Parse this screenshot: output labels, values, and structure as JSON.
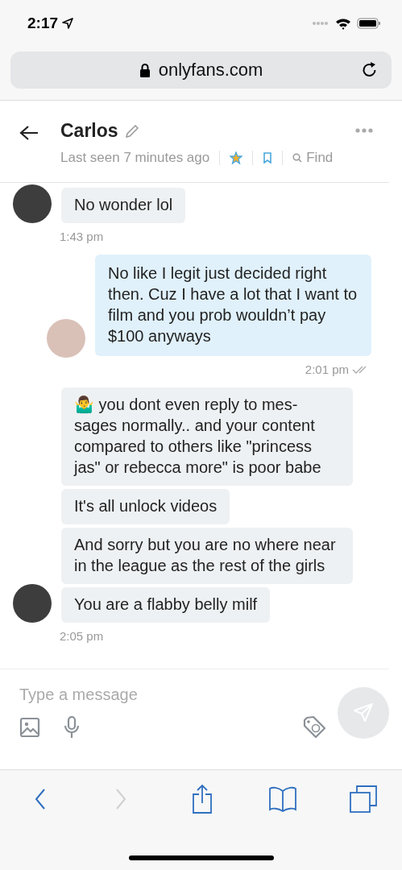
{
  "status_bar": {
    "time": "2:17"
  },
  "address_bar": {
    "url": "onlyfans.com"
  },
  "chat_header": {
    "name": "Carlos",
    "last_seen": "Last seen 7 minutes ago",
    "starred": true,
    "find_label": "Find"
  },
  "messages": [
    {
      "kind": "incoming",
      "bubbles": [
        "No wonder lol"
      ],
      "time": "1:43 pm"
    },
    {
      "kind": "outgoing",
      "bubbles": [
        "No like I legit just decided right then. Cuz I have a lot that I want to film and you prob wouldn’t pay $100 anyways"
      ],
      "time": "2:01 pm",
      "read": true
    },
    {
      "kind": "incoming",
      "bubbles": [
        "🤷‍♂️ you dont even reply to mes-sages normally.. and your content compared to others like \"princess jas\" or rebecca more\" is poor babe",
        "It's all unlock videos",
        "And sorry but you are no where near in the league as the rest of the girls",
        "You are a flabby belly milf"
      ],
      "time": "2:05 pm"
    }
  ],
  "composer": {
    "placeholder": "Type a message"
  },
  "toolbar": [
    {
      "kind": "back",
      "disabled": false
    },
    {
      "kind": "forward",
      "disabled": true
    },
    {
      "kind": "share",
      "disabled": false
    },
    {
      "kind": "bookmarks",
      "disabled": false
    },
    {
      "kind": "tabs",
      "disabled": false
    }
  ]
}
